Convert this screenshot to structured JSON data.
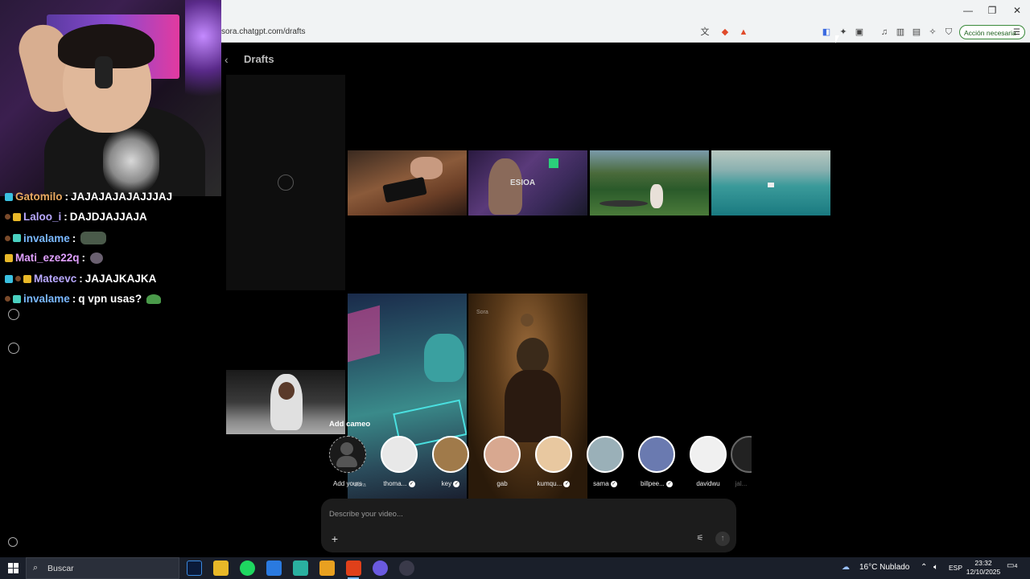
{
  "browser": {
    "url": "sora.chatgpt.com/drafts",
    "action_button": "Acción necesaria",
    "window_controls": {
      "minimize": "—",
      "maximize": "❐",
      "close": "✕"
    }
  },
  "chat": {
    "messages": [
      {
        "user": "Gatomilo",
        "text": "JAJAJAJAJAJJJAJ"
      },
      {
        "user": "Laloo_i",
        "text": "DAJDJAJJAJA"
      },
      {
        "user": "invalame",
        "text": ""
      },
      {
        "user": "Mati_eze22q",
        "text": ""
      },
      {
        "user": "Mateevc",
        "text": "JAJAJKAJKA"
      },
      {
        "user": "invalame",
        "text": "q vpn usas?"
      }
    ]
  },
  "page": {
    "title": "Drafts",
    "add_cameo_label": "Add cameo",
    "watermark": "Sora",
    "cameos": [
      {
        "name": "Add yours",
        "verified": false,
        "color": "#1a1a1a"
      },
      {
        "name": "thoma...",
        "verified": true,
        "color": "#e8e8e8"
      },
      {
        "name": "key",
        "verified": true,
        "color": "#a07a4a"
      },
      {
        "name": "gab",
        "verified": false,
        "color": "#d8a890"
      },
      {
        "name": "kumqu...",
        "verified": true,
        "color": "#e8c8a0"
      },
      {
        "name": "sama",
        "verified": true,
        "color": "#9ab0b8"
      },
      {
        "name": "billpee...",
        "verified": true,
        "color": "#6a7ab0"
      },
      {
        "name": "davidwu",
        "verified": false,
        "color": "#f0f0f0"
      },
      {
        "name": "jal...",
        "verified": false,
        "color": "#555"
      }
    ],
    "prompt": {
      "placeholder": "Describe your video..."
    }
  },
  "taskbar": {
    "search_label": "Buscar",
    "weather": "16°C  Nublado",
    "language": "ESP",
    "time": "23:32",
    "date": "12/10/2025",
    "notifications": "4"
  }
}
